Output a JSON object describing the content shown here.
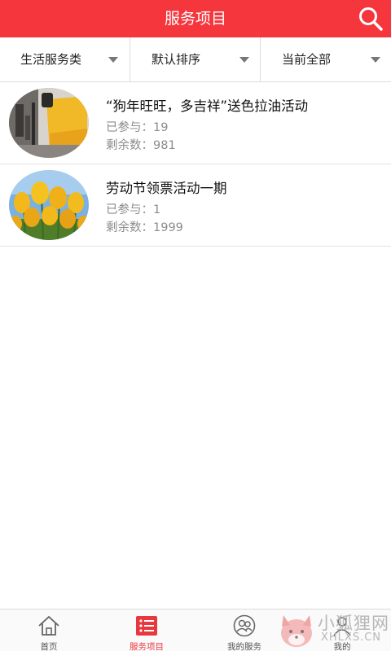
{
  "header": {
    "title": "服务项目",
    "search_icon": "search-icon"
  },
  "filters": [
    {
      "label": "生活服务类"
    },
    {
      "label": "默认排序"
    },
    {
      "label": "当前全部"
    }
  ],
  "items": [
    {
      "title": "“狗年旺旺，多吉祥”送色拉油活动",
      "joined": "已参与：19",
      "remaining": "剩余数：981",
      "image": "photo-studio-image"
    },
    {
      "title": "劳动节领票活动一期",
      "joined": "已参与：1",
      "remaining": "剩余数：1999",
      "image": "tulips-image"
    }
  ],
  "tabbar": {
    "active_color": "#e8373d",
    "tabs": [
      {
        "label": "首页",
        "icon": "home-icon"
      },
      {
        "label": "服务项目",
        "icon": "list-icon",
        "active": true
      },
      {
        "label": "我的服务",
        "icon": "users-icon"
      },
      {
        "label": "我的",
        "icon": "person-icon"
      }
    ]
  },
  "watermark": {
    "text_cn": "小狐狸网",
    "text_en": "XHLXS.CN"
  },
  "colors": {
    "brand_red": "#f5373d"
  }
}
